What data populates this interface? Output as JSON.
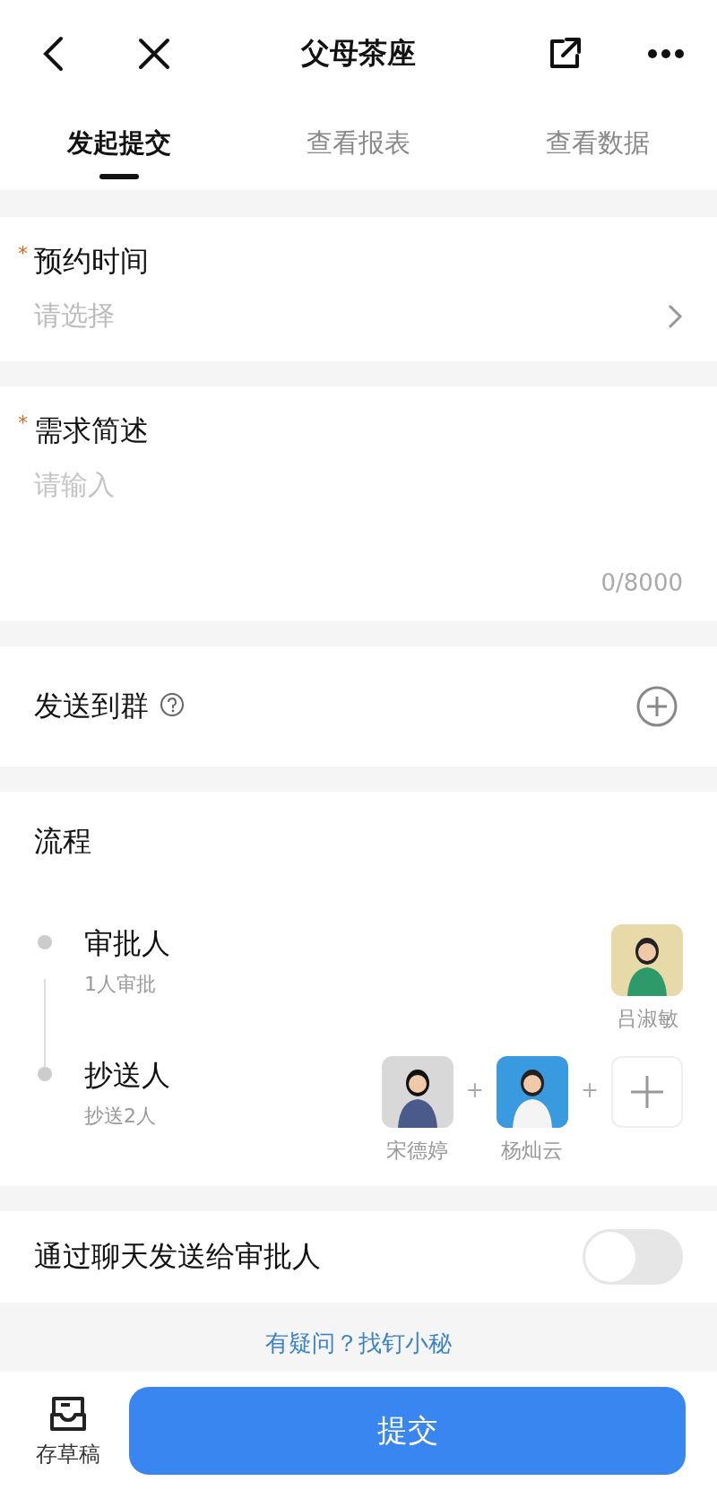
{
  "header": {
    "title": "父母茶座"
  },
  "tabs": [
    {
      "label": "发起提交",
      "selected": true
    },
    {
      "label": "查看报表",
      "selected": false
    },
    {
      "label": "查看数据",
      "selected": false
    }
  ],
  "fields": [
    {
      "kind": "select",
      "label": "预约时间",
      "required_mark": "*",
      "placeholder": "请选择"
    },
    {
      "kind": "textarea",
      "label": "需求简述",
      "required_mark": "*",
      "placeholder": "请输入",
      "counter": "0/8000"
    },
    {
      "kind": "group",
      "label": "发送到群"
    }
  ],
  "flow": {
    "title": "流程",
    "steps": [
      {
        "label": "审批人",
        "sub": "1人审批",
        "people": [
          {
            "name": "吕淑敏",
            "kind": "picture"
          }
        ]
      },
      {
        "label": "抄送人",
        "sub": "抄送2人",
        "people": [
          {
            "name": "宋德婷",
            "kind": "picture"
          },
          {
            "joiner": "+",
            "name": "杨灿云",
            "kind": "picture"
          }
        ],
        "add": {
          "joiner": "+"
        }
      }
    ]
  },
  "chat_toggle": {
    "label": "通过聊天发送给审批人",
    "on": false
  },
  "help": {
    "text": "有疑问？找钉小秘"
  },
  "bottom": {
    "draft": "存草稿",
    "submit": "提交"
  }
}
